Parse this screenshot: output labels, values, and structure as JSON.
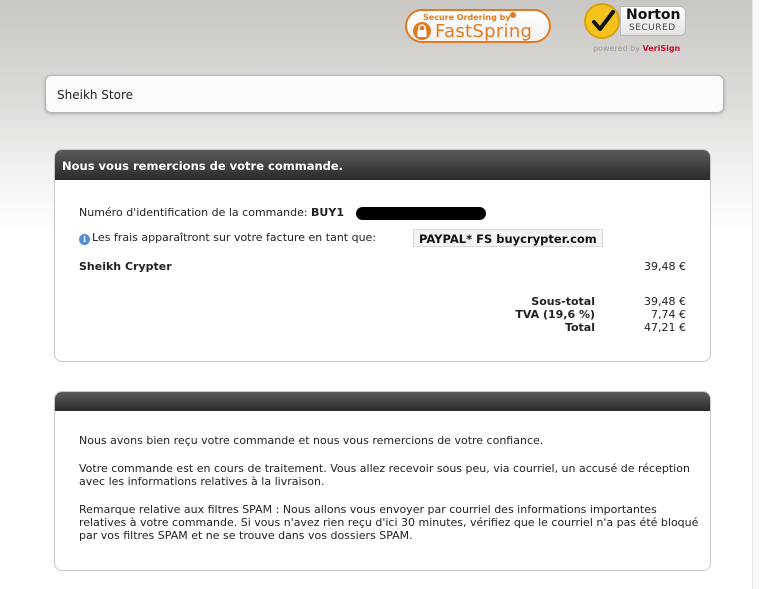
{
  "badges": {
    "fastspring_secure": "Secure Ordering by",
    "fastspring_name": "FastSpring",
    "norton_name": "Norton",
    "norton_secured": "SECURED",
    "norton_powered": "powered by",
    "norton_verisign": "VeriSign"
  },
  "store": {
    "name": "Sheikh Store"
  },
  "order_panel": {
    "title": "Nous vous remercions de votre commande.",
    "order_id_label": "Numéro d'identification de la commande:",
    "order_id_value": "BUY1",
    "charge_note": "Les frais apparaîtront sur votre facture en tant que:",
    "charge_descriptor": "PAYPAL* FS buycrypter.com",
    "product_name": "Sheikh Crypter",
    "product_price": "39,48 €",
    "subtotal_label": "Sous-total",
    "subtotal_value": "39,48 €",
    "tax_label": "TVA (19,6 %)",
    "tax_value": "7,74 €",
    "total_label": "Total",
    "total_value": "47,21 €"
  },
  "message_panel": {
    "title": "",
    "paragraph1": "Nous avons bien reçu votre commande et nous vous remercions de votre confiance.",
    "paragraph2": "Votre commande est en cours de traitement. Vous allez recevoir sous peu, via courriel, un accusé de réception avec les informations relatives à la livraison.",
    "paragraph3": "Remarque relative aux filtres SPAM : Nous allons vous envoyer par courriel des informations importantes relatives à votre commande. Si vous n'avez rien reçu d'ici 30 minutes, vérifiez que le courriel n'a pas été bloqué par vos filtres SPAM et ne se trouve dans vos dossiers SPAM."
  },
  "colors": {
    "fastspring_orange": "#e07b22",
    "norton_yellow": "#f3c21c",
    "panel_header": "#2a2a2a",
    "info_blue": "#4f8fd6"
  }
}
